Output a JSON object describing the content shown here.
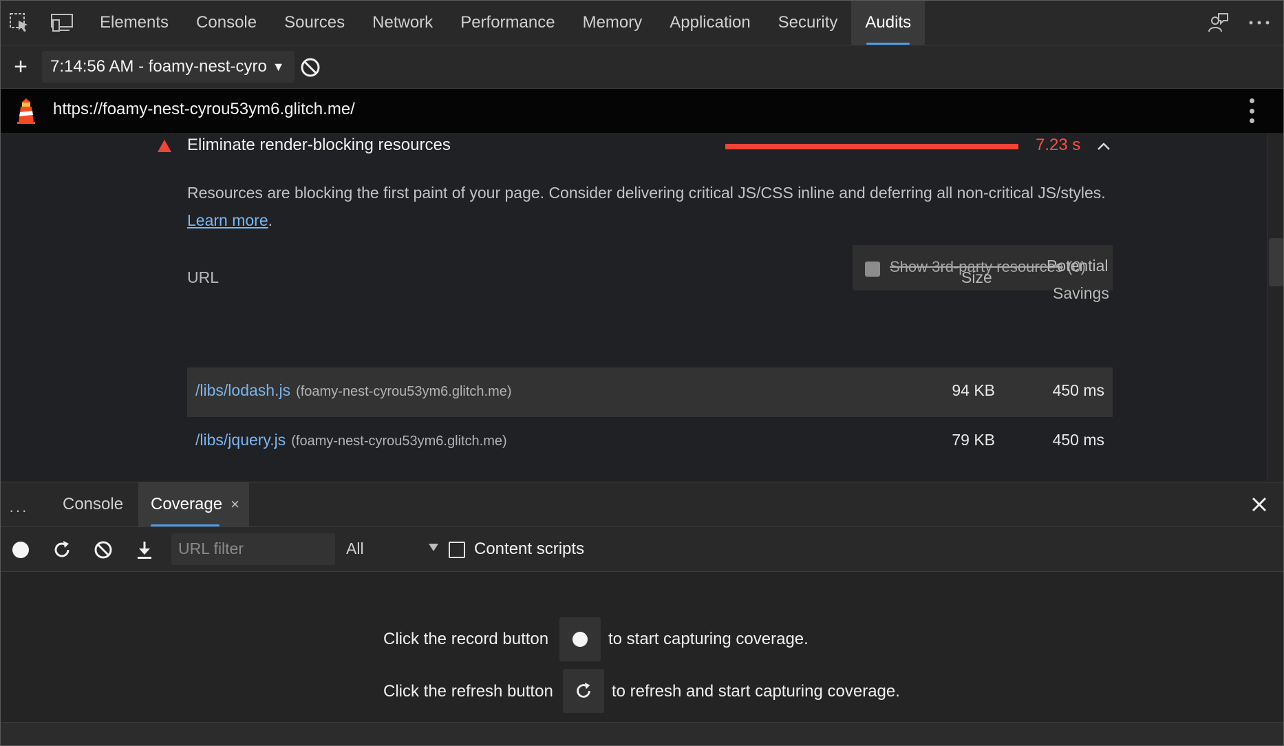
{
  "main_tabs": [
    "Elements",
    "Console",
    "Sources",
    "Network",
    "Performance",
    "Memory",
    "Application",
    "Security",
    "Audits"
  ],
  "active_main_tab": "Audits",
  "report_toolbar": {
    "add_label": "+",
    "report_select": "7:14:56 AM - foamy-nest-cyro"
  },
  "url_bar": {
    "url": "https://foamy-nest-cyrou53ym6.glitch.me/"
  },
  "audit": {
    "title": "Eliminate render-blocking resources",
    "savings": "7.23 s",
    "description": "Resources are blocking the first paint of your page. Consider delivering critical JS/CSS inline and deferring all non-critical JS/styles. ",
    "learn_more": "Learn more",
    "desc_end": ".",
    "third_party_label": "Show 3rd-party resources",
    "third_party_count": " (0)",
    "columns": {
      "url": "URL",
      "size": "Size",
      "savings_line1": "Potential",
      "savings_line2": "Savings"
    },
    "rows": [
      {
        "path": "/libs/lodash.js",
        "host": "(foamy-nest-cyrou53ym6.glitch.me)",
        "size": "94 KB",
        "savings": "450 ms"
      },
      {
        "path": "/libs/jquery.js",
        "host": "(foamy-nest-cyrou53ym6.glitch.me)",
        "size": "79 KB",
        "savings": "450 ms"
      }
    ]
  },
  "drawer": {
    "more_label": "···",
    "tabs": [
      "Console",
      "Coverage"
    ],
    "active_tab": "Coverage",
    "tab_close": "×"
  },
  "coverage": {
    "url_filter_placeholder": "URL filter",
    "type_filter": "All",
    "content_scripts_label": "Content scripts",
    "record_msg_before": "Click the record button",
    "record_msg_after": "to start capturing coverage.",
    "refresh_msg_before": "Click the refresh button",
    "refresh_msg_after": "to refresh and start capturing coverage."
  },
  "colors": {
    "accent": "#4c9fef",
    "fail": "#ef4436",
    "link": "#77b8f4"
  }
}
